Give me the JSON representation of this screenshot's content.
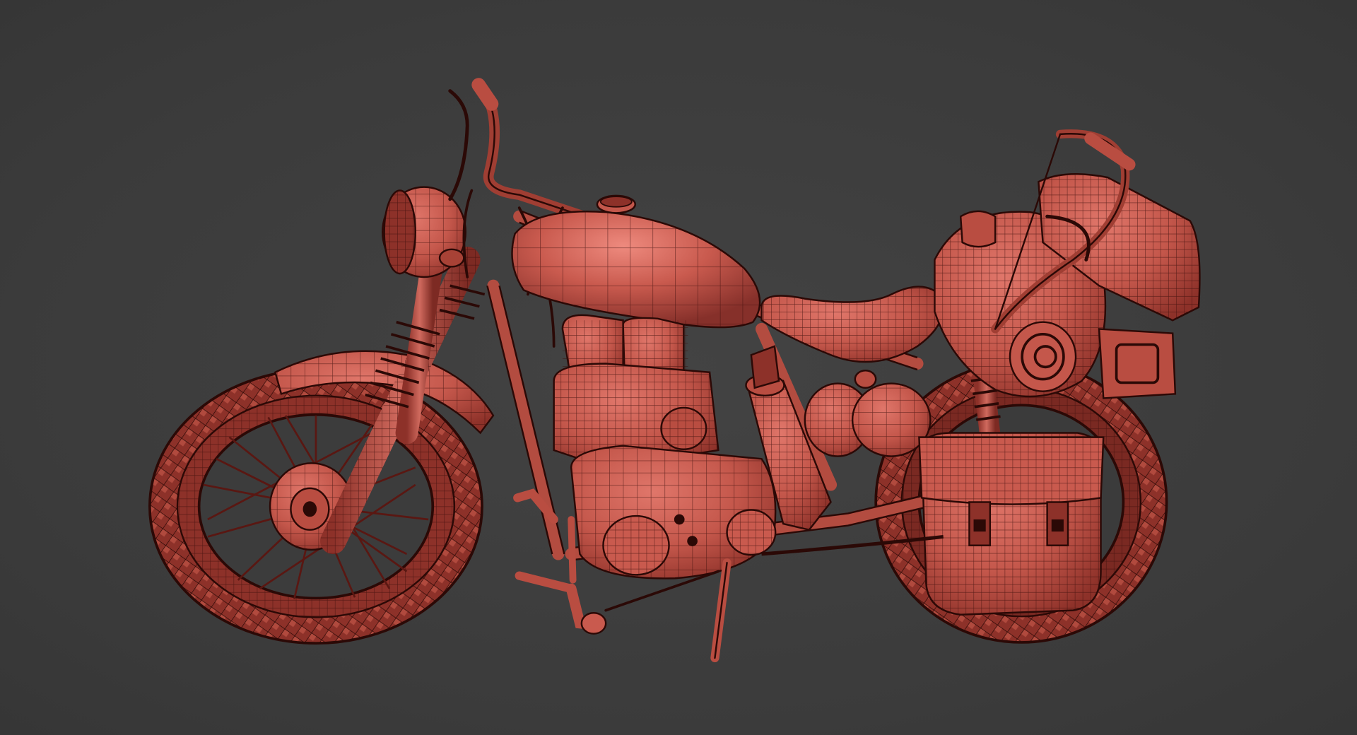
{
  "viewport": {
    "background": "#3d3d3d",
    "subject": "motorcycle-wireframe-model"
  },
  "model": {
    "base_color": "#c4574b",
    "shade_color": "#8d3129",
    "highlight_color": "#e0766a",
    "wire_color": "#3a0d0a",
    "dark_color": "#2b0906"
  },
  "icons": [
    "motorcycle-model-icon",
    "front-wheel-icon",
    "rear-wheel-icon",
    "fuel-tank-icon",
    "seat-icon",
    "headlight-icon",
    "saddlebag-icon",
    "engine-icon",
    "crossbow-icon",
    "bedroll-icon",
    "kickstand-icon",
    "handlebar-icon",
    "front-fork-icon",
    "exhaust-icon"
  ]
}
